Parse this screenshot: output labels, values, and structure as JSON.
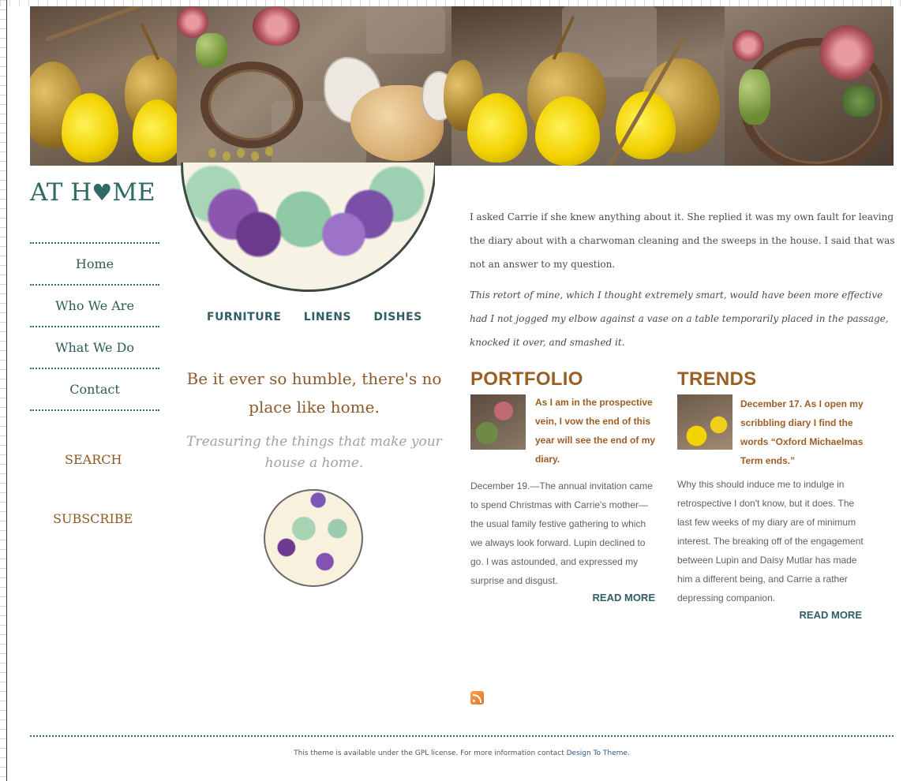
{
  "brand": {
    "logo_prefix": "AT H",
    "logo_heart": "♥",
    "logo_suffix": "ME"
  },
  "nav": {
    "items": [
      "Home",
      "Who We Are",
      "What We Do",
      "Contact"
    ]
  },
  "sidebar": {
    "search": "SEARCH",
    "subscribe": "SUBSCRIBE"
  },
  "categories": [
    "FURNITURE",
    "LINENS",
    "DISHES"
  ],
  "tagline": "Be it ever so humble, there's no place like home.",
  "subtagline": "Treasuring the things that make your house a home.",
  "intro": {
    "p1": "I asked Carrie if she knew anything about it. She replied it was my own fault for leaving the diary about with a charwoman cleaning and the sweeps in the house. I said that was not an answer to my question.",
    "p2": "This retort of mine, which I thought extremely smart, would have been more effective had I not jogged my elbow against a vase on a table temporarily placed in the passage, knocked it over, and smashed it."
  },
  "portfolio": {
    "title": "PORTFOLIO",
    "lead": "As I am in the prospective vein, I vow the end of this year will see the end of my diary.",
    "body": "December 19.—The annual invitation came to spend Christmas with Carrie's mother—the usual family festive gathering to which we always look forward. Lupin declined to go. I was astounded, and expressed my surprise and disgust.",
    "more": "READ MORE"
  },
  "trends": {
    "title": "TRENDS",
    "lead": "December 17. As I open my scribbling diary I find the words “Oxford Michaelmas Term ends.”",
    "body": "Why this should induce me to indulge in retrospective I don't know, but it does. The last few weeks of my diary are of minimum interest. The breaking off of the engagement between Lupin and Daisy Mutlar has made him a different being, and Carrie a rather depressing companion.",
    "more": "READ MORE"
  },
  "footer": {
    "text": "This theme is available under the GPL license. For more information contact ",
    "link": "Design To Theme",
    "end": "."
  },
  "colors": {
    "teal": "#2f6a64",
    "brown": "#9b5e25",
    "gray_text": "#606060"
  }
}
